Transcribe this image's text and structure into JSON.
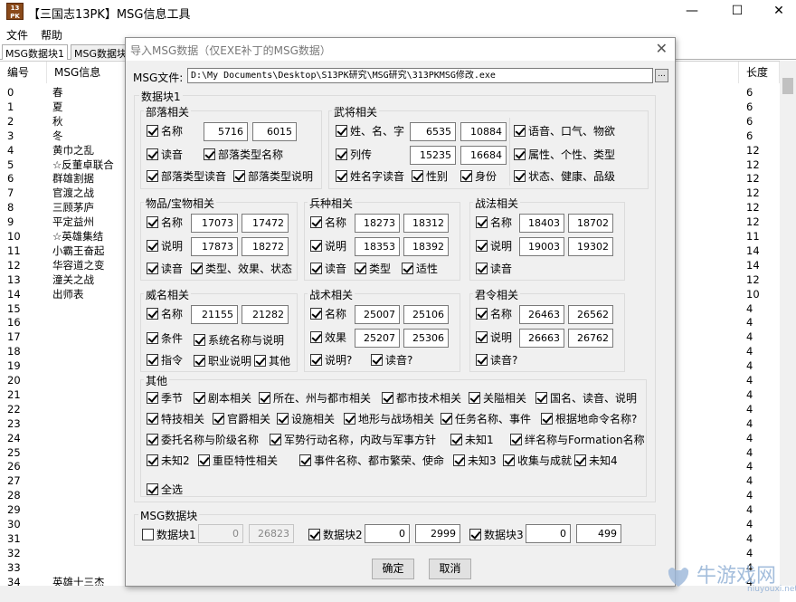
{
  "window": {
    "icon_text": "13\nPK",
    "title": "【三国志13PK】MSG信息工具",
    "min": "—",
    "max": "☐",
    "close": "✕"
  },
  "menu": [
    "文件",
    "帮助"
  ],
  "tabs": [
    "MSG数据块1",
    "MSG数据块"
  ],
  "list": {
    "col_num": "编号",
    "col_msg": "MSG信息",
    "col_len": "长度",
    "rows": [
      {
        "n": "0",
        "m": "春",
        "l": "6"
      },
      {
        "n": "1",
        "m": "夏",
        "l": "6"
      },
      {
        "n": "2",
        "m": "秋",
        "l": "6"
      },
      {
        "n": "3",
        "m": "冬",
        "l": "6"
      },
      {
        "n": "4",
        "m": "黄巾之乱",
        "l": "12"
      },
      {
        "n": "5",
        "m": "☆反董卓联合",
        "l": "12"
      },
      {
        "n": "6",
        "m": "群雄割据",
        "l": "12"
      },
      {
        "n": "7",
        "m": "官渡之战",
        "l": "12"
      },
      {
        "n": "8",
        "m": "三顾茅庐",
        "l": "12"
      },
      {
        "n": "9",
        "m": "平定益州",
        "l": "12"
      },
      {
        "n": "10",
        "m": "☆英雄集结",
        "l": "11"
      },
      {
        "n": "11",
        "m": "小霸王奋起",
        "l": "14"
      },
      {
        "n": "12",
        "m": "华容道之变",
        "l": "14"
      },
      {
        "n": "13",
        "m": "潼关之战",
        "l": "12"
      },
      {
        "n": "14",
        "m": "出师表",
        "l": "10"
      },
      {
        "n": "15",
        "m": "",
        "l": "4"
      },
      {
        "n": "16",
        "m": "",
        "l": "4"
      },
      {
        "n": "17",
        "m": "",
        "l": "4"
      },
      {
        "n": "18",
        "m": "",
        "l": "4"
      },
      {
        "n": "19",
        "m": "",
        "l": "4"
      },
      {
        "n": "20",
        "m": "",
        "l": "4"
      },
      {
        "n": "21",
        "m": "",
        "l": "4"
      },
      {
        "n": "22",
        "m": "",
        "l": "4"
      },
      {
        "n": "23",
        "m": "",
        "l": "4"
      },
      {
        "n": "24",
        "m": "",
        "l": "4"
      },
      {
        "n": "25",
        "m": "",
        "l": "4"
      },
      {
        "n": "26",
        "m": "",
        "l": "4"
      },
      {
        "n": "27",
        "m": "",
        "l": "4"
      },
      {
        "n": "28",
        "m": "",
        "l": "4"
      },
      {
        "n": "29",
        "m": "",
        "l": "4"
      },
      {
        "n": "30",
        "m": "",
        "l": "4"
      },
      {
        "n": "31",
        "m": "",
        "l": "4"
      },
      {
        "n": "32",
        "m": "",
        "l": "4"
      },
      {
        "n": "33",
        "m": "",
        "l": "4"
      },
      {
        "n": "34",
        "m": "英雄十三杰",
        "l": "4"
      }
    ]
  },
  "dialog": {
    "title": "导入MSG数据（仅EXE补丁的MSG数据）",
    "close": "✕",
    "file_label": "MSG文件:",
    "file_path": "D:\\My Documents\\Desktop\\S13PK研究\\MSG研究\\313PKMSG修改.exe",
    "browse": "...",
    "block1_title": "数据块1",
    "tribe": {
      "title": "部落相关",
      "name": "名称",
      "name_from": "5716",
      "name_to": "6015",
      "read": "读音",
      "type_name": "部落类型名称",
      "type_read": "部落类型读音",
      "type_desc": "部落类型说明"
    },
    "general": {
      "title": "武将相关",
      "name": "姓、名、字",
      "name_from": "6535",
      "name_to": "10884",
      "bio": "列传",
      "bio_from": "15235",
      "bio_to": "16684",
      "voice": "语音、口气、物欲",
      "attr": "属性、个性、类型",
      "name_read": "姓名字读音",
      "gender": "性别",
      "status": "身份",
      "state": "状态、健康、品级"
    },
    "item": {
      "title": "物品/宝物相关",
      "name": "名称",
      "name_from": "17073",
      "name_to": "17472",
      "desc": "说明",
      "desc_from": "17873",
      "desc_to": "18272",
      "read": "读音",
      "type": "类型、效果、状态"
    },
    "troop": {
      "title": "兵种相关",
      "name": "名称",
      "name_from": "18273",
      "name_to": "18312",
      "desc": "说明",
      "desc_from": "18353",
      "desc_to": "18392",
      "read": "读音",
      "type": "类型",
      "fit": "适性"
    },
    "tactic": {
      "title": "战法相关",
      "name": "名称",
      "name_from": "18403",
      "name_to": "18702",
      "desc": "说明",
      "desc_from": "19003",
      "desc_to": "19302",
      "read": "读音"
    },
    "fame": {
      "title": "威名相关",
      "name": "名称",
      "name_from": "21155",
      "name_to": "21282",
      "cond": "条件",
      "sys": "系统名称与说明",
      "cmd": "指令",
      "job": "职业说明",
      "other": "其他"
    },
    "strat": {
      "title": "战术相关",
      "name": "名称",
      "name_from": "25007",
      "name_to": "25106",
      "effect": "效果",
      "effect_from": "25207",
      "effect_to": "25306",
      "desc": "说明?",
      "read": "读音?"
    },
    "order": {
      "title": "君令相关",
      "name": "名称",
      "name_from": "26463",
      "name_to": "26562",
      "desc": "说明",
      "desc_from": "26663",
      "desc_to": "26762",
      "read": "读音?"
    },
    "misc": {
      "title": "其他",
      "row1": [
        "季节",
        "剧本相关",
        "所在、州与都市相关",
        "都市技术相关",
        "关隘相关",
        "国名、读音、说明"
      ],
      "row2": [
        "特技相关",
        "官爵相关",
        "设施相关",
        "地形与战场相关",
        "任务名称、事件",
        "根据地命令名称?"
      ],
      "row3": [
        "委托名称与阶级名称",
        "军势行动名称，内政与军事方针",
        "未知1",
        "绊名称与Formation名称"
      ],
      "row4": [
        "未知2",
        "重臣特性相关",
        "事件名称、都市繁荣、使命",
        "未知3",
        "收集与成就",
        "未知4"
      ],
      "all": "全选"
    },
    "blocks": {
      "title": "MSG数据块",
      "b1": "数据块1",
      "b1_from": "0",
      "b1_to": "26823",
      "b2": "数据块2",
      "b2_from": "0",
      "b2_to": "2999",
      "b3": "数据块3",
      "b3_from": "0",
      "b3_to": "499"
    },
    "ok": "确定",
    "cancel": "取消"
  },
  "watermark": {
    "text": "牛游戏网",
    "url": "niuyouxi.net"
  },
  "colors": {
    "dialog_bg": "#f0f0f0",
    "watermark": "#9bb7d9",
    "disabled_text": "#888888"
  }
}
